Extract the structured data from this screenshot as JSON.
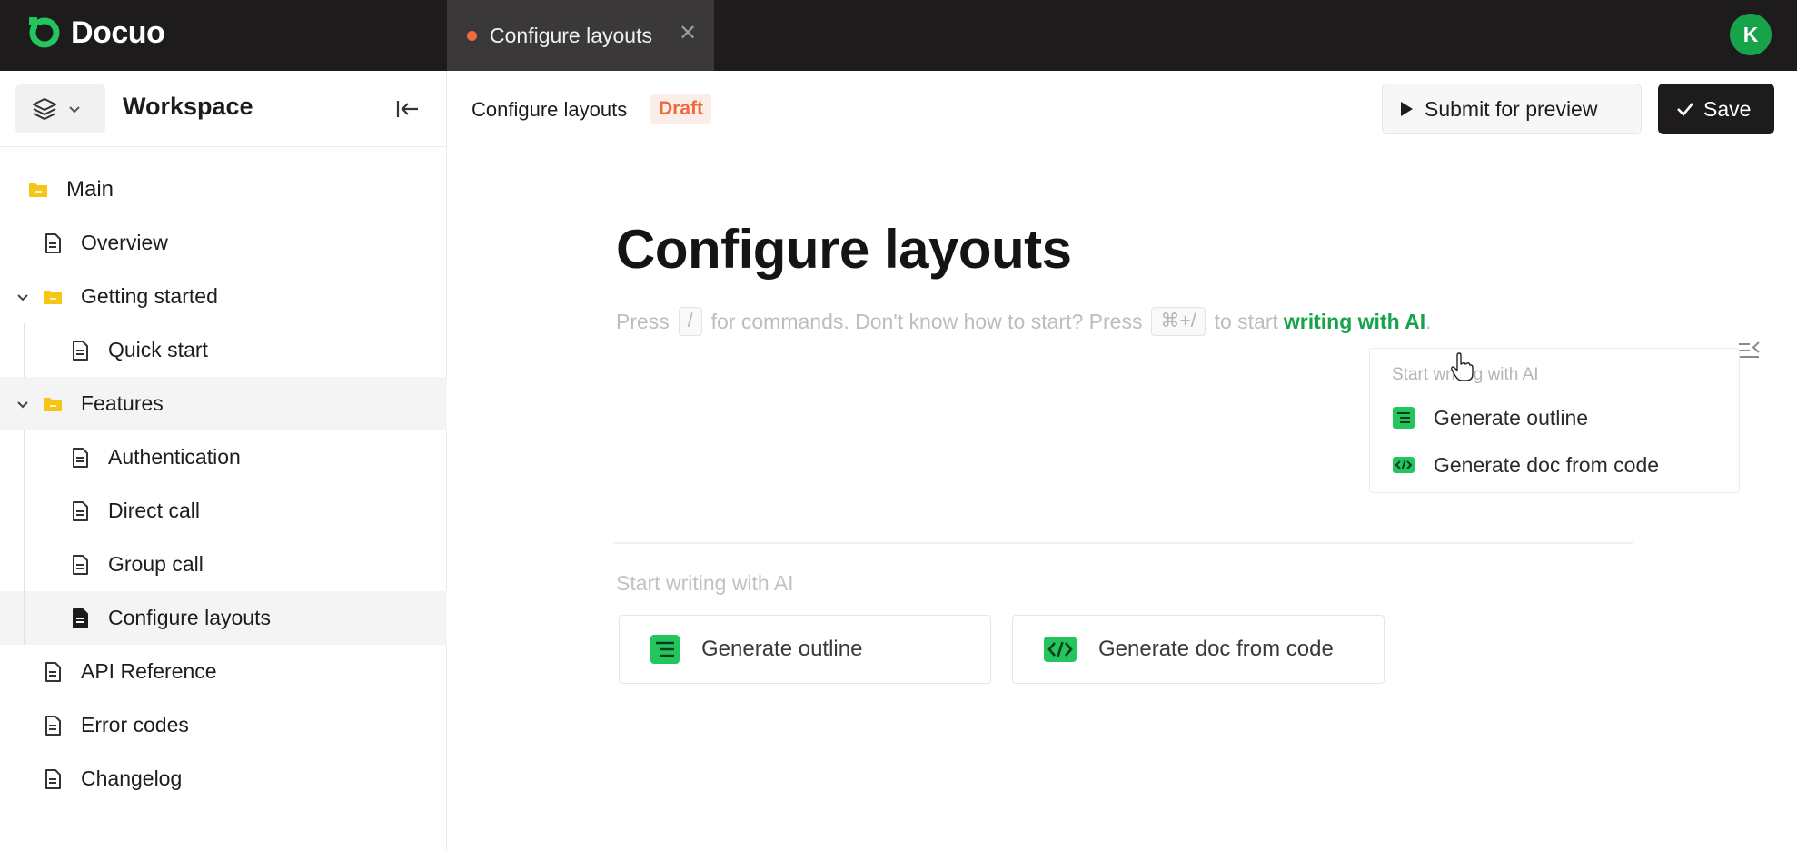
{
  "app": {
    "name": "Docuo",
    "user_initial": "K"
  },
  "tab": {
    "label": "Configure layouts",
    "close_glyph": "✕"
  },
  "sidebar": {
    "workspace_title": "Workspace",
    "items": [
      {
        "label": "Main",
        "icon": "folder-icon"
      },
      {
        "label": "Overview",
        "icon": "document-icon"
      },
      {
        "label": "Getting started",
        "icon": "folder-icon",
        "expanded": true
      },
      {
        "label": "Quick start",
        "icon": "document-icon"
      },
      {
        "label": "Features",
        "icon": "folder-icon",
        "expanded": true
      },
      {
        "label": "Authentication",
        "icon": "document-icon"
      },
      {
        "label": "Direct call",
        "icon": "document-icon"
      },
      {
        "label": "Group call",
        "icon": "document-icon"
      },
      {
        "label": "Configure layouts",
        "icon": "document-filled-icon",
        "selected": true
      },
      {
        "label": "API Reference",
        "icon": "document-icon"
      },
      {
        "label": "Error codes",
        "icon": "document-icon"
      },
      {
        "label": "Changelog",
        "icon": "document-icon"
      }
    ]
  },
  "header": {
    "breadcrumb": "Configure layouts",
    "status_badge": "Draft",
    "preview_label": "Submit for preview",
    "save_label": "Save"
  },
  "doc": {
    "title": "Configure layouts",
    "hint_press": "Press",
    "hint_slash_key": "/",
    "hint_middle": "for commands. Don't know how to start? Press",
    "hint_shortcut_key": "⌘+/",
    "hint_to_start": "to start",
    "hint_ai_link": "writing with AI",
    "hint_period": "."
  },
  "ai_dropdown": {
    "header": "Start writing with AI",
    "items": [
      "Generate outline",
      "Generate doc from code"
    ]
  },
  "ai_section": {
    "header": "Start writing with AI",
    "cards": [
      "Generate outline",
      "Generate doc from code"
    ]
  },
  "colors": {
    "accent": "#16a34a",
    "draft": "#f0673a",
    "topbar": "#1d1b1c",
    "folder": "#f5c518"
  }
}
